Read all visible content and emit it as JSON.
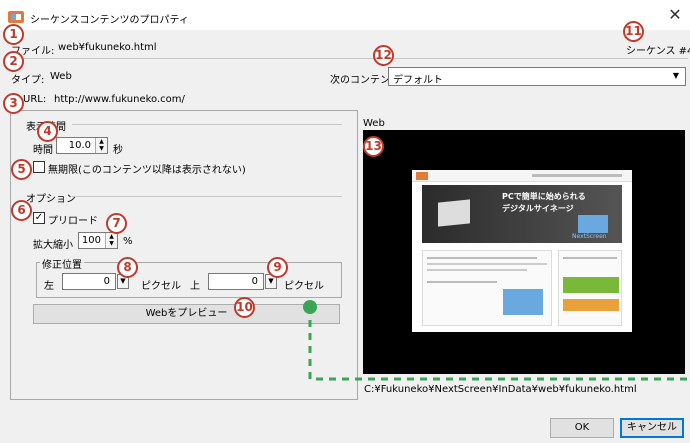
{
  "window": {
    "title": "シーケンスコンテンツのプロパティ",
    "close": "✕"
  },
  "info": {
    "file_label": "ファイル:",
    "file_value": "web¥fukuneko.html",
    "type_label": "タイプ:",
    "type_value": "Web",
    "url_label": "URL:",
    "url_value": "http://www.fukuneko.com/",
    "sequence": "シーケンス #4"
  },
  "next_content": {
    "label": "次のコンテンツ",
    "value": "デフォルト"
  },
  "display_time": {
    "group_label": "表示時間",
    "time_label": "時間",
    "time_value": "10.0",
    "time_unit": "秒",
    "unlimited_label": "無期限(このコンテンツ以降は表示されない)",
    "unlimited_checked": false
  },
  "options": {
    "group_label": "オプション",
    "preload_label": "プリロード",
    "preload_checked": true,
    "zoom_label": "拡大縮小",
    "zoom_value": "100",
    "zoom_unit": "%",
    "offset_group_label": "修正位置",
    "left_label": "左",
    "left_value": "0",
    "left_unit": "ピクセル",
    "top_label": "上",
    "top_value": "0",
    "top_unit": "ピクセル",
    "preview_button": "Webをプレビュー"
  },
  "preview": {
    "label": "Web",
    "path": "C:¥Fukuneko¥NextScreen¥InData¥web¥fukuneko.html",
    "site_headline_1": "PCで簡単に始められる",
    "site_headline_2": "デジタルサイネージ",
    "site_product": "NextScreen"
  },
  "footer": {
    "ok": "OK",
    "cancel": "キャンセル"
  },
  "annotations": [
    "1",
    "2",
    "3",
    "4",
    "5",
    "6",
    "7",
    "8",
    "9",
    "10",
    "11",
    "12",
    "13"
  ],
  "colors": {
    "annotation": "#c0392b",
    "connector": "#3aa655",
    "preview_bg": "#000000"
  },
  "icons": {
    "app": "app-icon",
    "close": "close-icon",
    "dropdown": "chevron-down-icon"
  }
}
